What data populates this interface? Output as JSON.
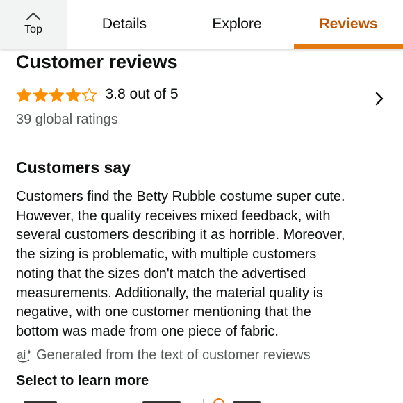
{
  "tabs": {
    "top_label": "Top",
    "details_label": "Details",
    "explore_label": "Explore",
    "reviews_label": "Reviews",
    "active": "Reviews"
  },
  "reviews": {
    "title": "Customer reviews",
    "rating_text": "3.8 out of 5",
    "rating_value": 3.8,
    "stars_filled": 4,
    "stars_total": 5,
    "global_ratings": "39 global ratings"
  },
  "customers_say": {
    "title": "Customers say",
    "summary_lines": [
      "Customers find the Betty Rubble costume super cute.",
      "However, the quality receives mixed feedback, with",
      "several customers describing it as horrible. Moreover,",
      "the sizing is problematic, with multiple customers",
      "noting that the sizes don't match the advertised",
      "measurements. Additionally, the material quality is",
      "negative, with one customer mentioning that the",
      "bottom was made from one piece of fabric."
    ],
    "generated_text": "Generated from the text of customer reviews",
    "select_more": "Select to learn more"
  },
  "colors": {
    "accent_orange": "#e47911",
    "reviews_tab_text": "#c45500",
    "star_orange": "#ff8f00",
    "secondary_text": "#565959"
  },
  "icons": {
    "top": "chevron-up-icon",
    "see_all": "chevron-right-icon",
    "star_filled": "star-filled-icon",
    "star_empty": "star-outline-icon",
    "ai": "ai-generated-icon"
  }
}
